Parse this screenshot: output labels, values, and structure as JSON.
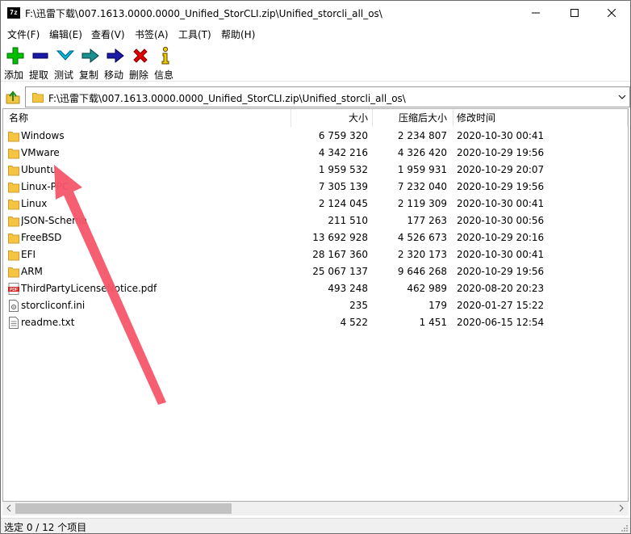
{
  "window": {
    "app_icon_text": "7z",
    "title": "F:\\迅雷下载\\007.1613.0000.0000_Unified_StorCLI.zip\\Unified_storcli_all_os\\"
  },
  "menu": [
    "文件(F)",
    "编辑(E)",
    "查看(V)",
    "书签(A)",
    "工具(T)",
    "帮助(H)"
  ],
  "toolbar": [
    {
      "label": "添加",
      "icon": "add-icon",
      "color": "#00c000"
    },
    {
      "label": "提取",
      "icon": "extract-icon",
      "color": "#1a1aa6"
    },
    {
      "label": "测试",
      "icon": "test-icon",
      "color": "#00a8c8"
    },
    {
      "label": "复制",
      "icon": "copy-icon",
      "color": "#1a8a8a"
    },
    {
      "label": "移动",
      "icon": "move-icon",
      "color": "#1a1aa6"
    },
    {
      "label": "删除",
      "icon": "delete-icon",
      "color": "#e00000"
    },
    {
      "label": "信息",
      "icon": "info-icon",
      "color": "#d8c000"
    }
  ],
  "address": {
    "path": "F:\\迅雷下载\\007.1613.0000.0000_Unified_StorCLI.zip\\Unified_storcli_all_os\\"
  },
  "columns": [
    "名称",
    "大小",
    "压缩后大小",
    "修改时间"
  ],
  "files": [
    {
      "name": "Windows",
      "type": "folder",
      "size": "6 759 320",
      "packed": "2 234 807",
      "modified": "2020-10-30 00:41"
    },
    {
      "name": "VMware",
      "type": "folder",
      "size": "4 342 216",
      "packed": "4 326 420",
      "modified": "2020-10-29 19:56"
    },
    {
      "name": "Ubuntu",
      "type": "folder",
      "size": "1 959 532",
      "packed": "1 959 931",
      "modified": "2020-10-29 20:07"
    },
    {
      "name": "Linux-PPC",
      "type": "folder",
      "size": "7 305 139",
      "packed": "7 232 040",
      "modified": "2020-10-29 19:56"
    },
    {
      "name": "Linux",
      "type": "folder",
      "size": "2 124 045",
      "packed": "2 119 309",
      "modified": "2020-10-30 00:41"
    },
    {
      "name": "JSON-Schema",
      "type": "folder",
      "size": "211 510",
      "packed": "177 263",
      "modified": "2020-10-30 00:56"
    },
    {
      "name": "FreeBSD",
      "type": "folder",
      "size": "13 692 928",
      "packed": "4 526 673",
      "modified": "2020-10-29 20:16"
    },
    {
      "name": "EFI",
      "type": "folder",
      "size": "28 167 360",
      "packed": "2 320 173",
      "modified": "2020-10-30 00:41"
    },
    {
      "name": "ARM",
      "type": "folder",
      "size": "25 067 137",
      "packed": "9 646 268",
      "modified": "2020-10-29 19:56"
    },
    {
      "name": "ThirdPartyLicenseNotice.pdf",
      "type": "pdf",
      "size": "493 248",
      "packed": "462 989",
      "modified": "2020-08-20 20:23"
    },
    {
      "name": "storcliconf.ini",
      "type": "ini",
      "size": "235",
      "packed": "179",
      "modified": "2020-01-27 15:22"
    },
    {
      "name": "readme.txt",
      "type": "txt",
      "size": "4 522",
      "packed": "1 451",
      "modified": "2020-06-15 12:54"
    }
  ],
  "status": "选定 0 / 12 个项目",
  "colors": {
    "annotation_arrow": "#f5566a",
    "folder": "#f5c542"
  }
}
